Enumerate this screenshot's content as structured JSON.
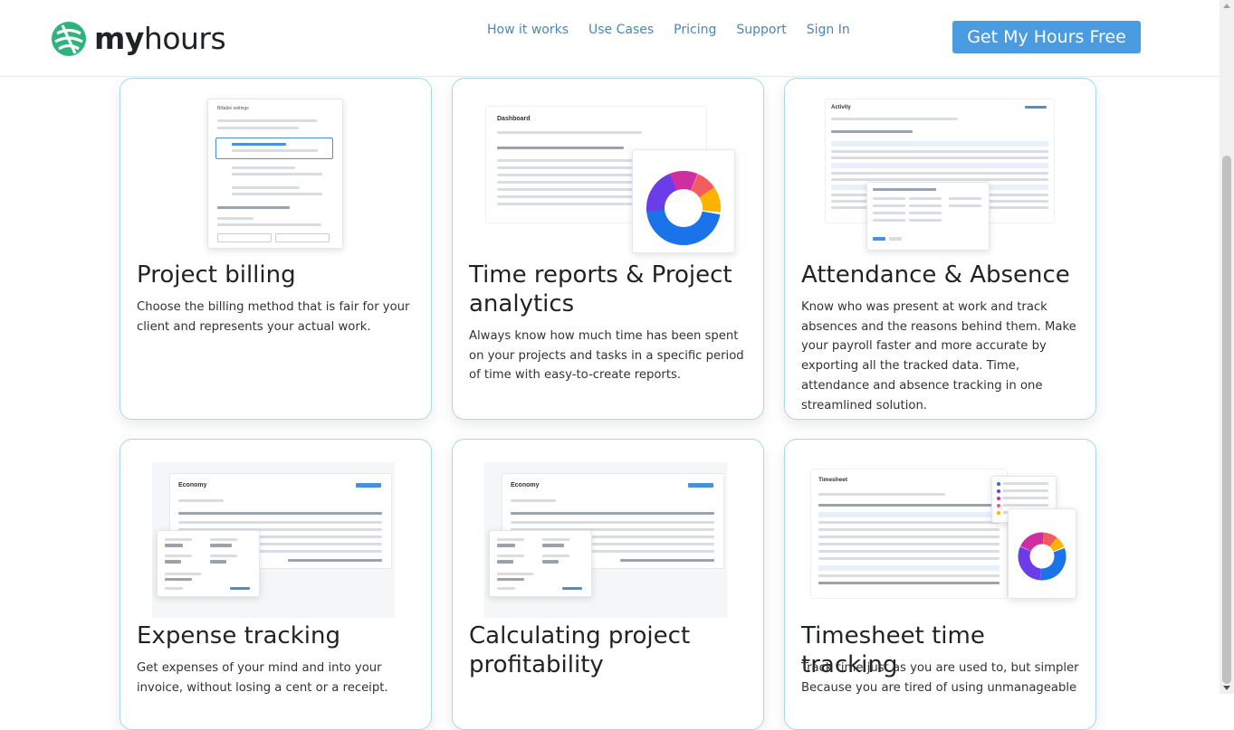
{
  "header": {
    "logo_bold": "my",
    "logo_light": "hours",
    "nav": [
      "How it works",
      "Use Cases",
      "Pricing",
      "Support",
      "Sign In"
    ],
    "cta_label": "Get My Hours Free"
  },
  "brand_colors": {
    "accent": "#4a9be0",
    "logo_green": "#2fb27d",
    "nav_link": "#4a86b8",
    "card_border": "#a9d8e3"
  },
  "cards": [
    {
      "title": "Project billing",
      "description": "Choose the billing method that is fair for your client and represents your actual work.",
      "screenshot_heading": "Billable settings"
    },
    {
      "title": "Time reports & Project analytics",
      "description": "Always know how much time has been spent on your projects and tasks in a specific period of time with easy-to-create reports.",
      "screenshot_heading": "Dashboard"
    },
    {
      "title": "Attendance & Absence",
      "description": "Know who was present at work and track absences and the reasons behind them. Make your payroll faster and more accurate by exporting all the tracked data. Time, attendance and absence tracking in one streamlined solution.",
      "screenshot_heading": "Activity"
    },
    {
      "title": "Expense tracking",
      "description": "Get expenses of your mind and into your invoice, without losing a cent or a receipt.",
      "screenshot_heading": "Economy"
    },
    {
      "title": "Calculating project profitability",
      "description": "",
      "screenshot_heading": "Economy"
    },
    {
      "title": "Timesheet time tracking",
      "description": "Track time just as you are used to, but simpler Because you are tired of using unmanageable",
      "screenshot_heading": "Timesheet"
    }
  ]
}
